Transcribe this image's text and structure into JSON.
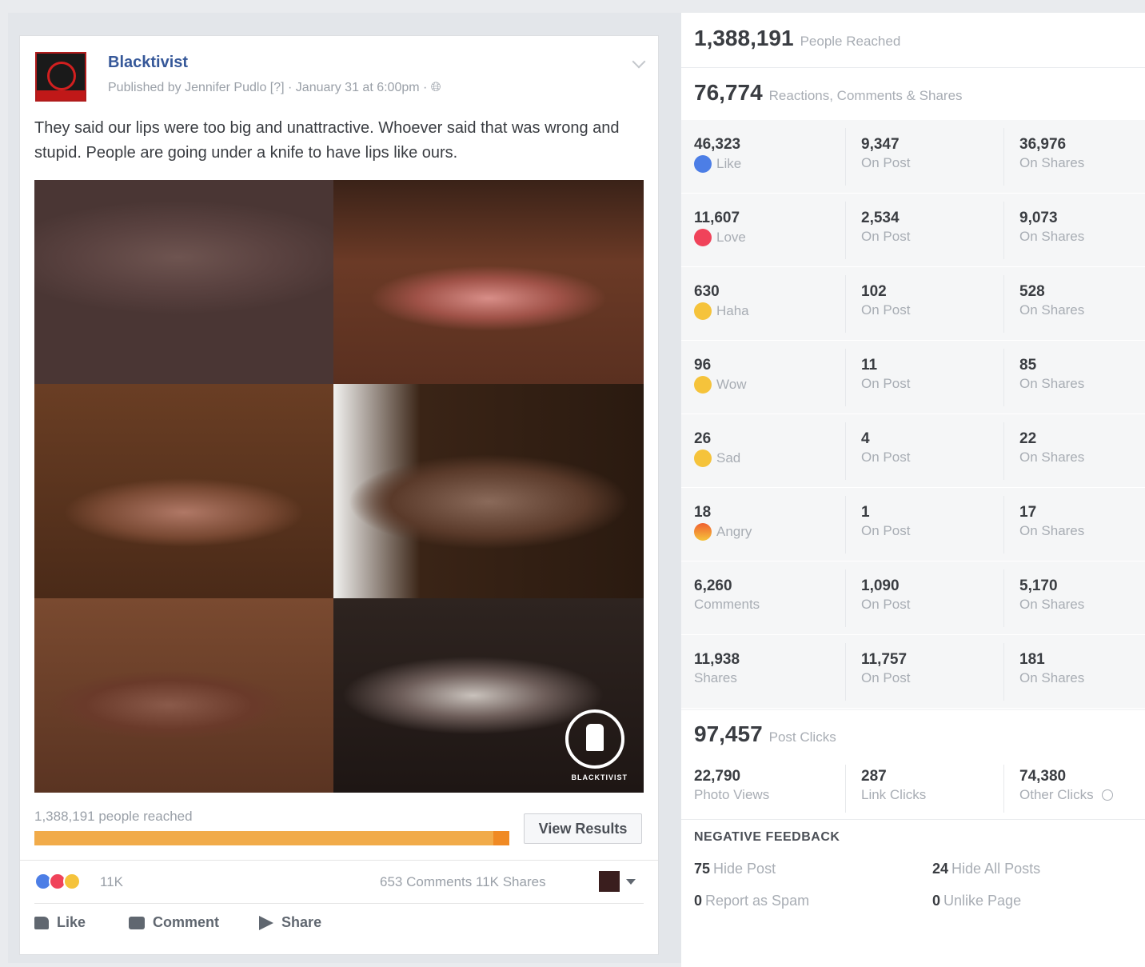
{
  "post": {
    "page_name": "Blacktivist",
    "meta": "Published by Jennifer Pudlo [?] · January 31 at 6:00pm · ",
    "text": "They said our lips were too big and unattractive. Whoever said that was wrong and stupid. People are going under a knife to have lips like ours.",
    "logo_word": "BLACKTIVIST",
    "reach_text": "1,388,191 people reached",
    "view_results_label": "View Results",
    "reaction_count": "11K",
    "comments_shares": "653 Comments  11K Shares",
    "actions": {
      "like": "Like",
      "comment": "Comment",
      "share": "Share"
    },
    "reach_fill_fraction": 1.0
  },
  "insights": {
    "people_reached": {
      "value": "1,388,191",
      "label": "People Reached"
    },
    "engagement": {
      "value": "76,774",
      "label": "Reactions, Comments & Shares"
    },
    "rows": [
      {
        "icon": "like-icon",
        "total": "46,323",
        "label": "Like",
        "on_post": "9,347",
        "on_shares": "36,976"
      },
      {
        "icon": "love-icon",
        "total": "11,607",
        "label": "Love",
        "on_post": "2,534",
        "on_shares": "9,073"
      },
      {
        "icon": "haha-icon",
        "total": "630",
        "label": "Haha",
        "on_post": "102",
        "on_shares": "528"
      },
      {
        "icon": "wow-icon",
        "total": "96",
        "label": "Wow",
        "on_post": "11",
        "on_shares": "85"
      },
      {
        "icon": "sad-icon",
        "total": "26",
        "label": "Sad",
        "on_post": "4",
        "on_shares": "22"
      },
      {
        "icon": "angry-icon",
        "total": "18",
        "label": "Angry",
        "on_post": "1",
        "on_shares": "17"
      },
      {
        "icon": "",
        "total": "6,260",
        "label": "Comments",
        "on_post": "1,090",
        "on_shares": "5,170"
      },
      {
        "icon": "",
        "total": "11,938",
        "label": "Shares",
        "on_post": "11,757",
        "on_shares": "181"
      }
    ],
    "on_post_label": "On Post",
    "on_shares_label": "On Shares",
    "post_clicks": {
      "value": "97,457",
      "label": "Post Clicks"
    },
    "clicks": [
      {
        "value": "22,790",
        "label": "Photo Views"
      },
      {
        "value": "287",
        "label": "Link Clicks"
      },
      {
        "value": "74,380",
        "label": "Other Clicks"
      }
    ],
    "negative_feedback": {
      "title": "NEGATIVE FEEDBACK",
      "items": [
        {
          "value": "75",
          "label": "Hide Post"
        },
        {
          "value": "24",
          "label": "Hide All Posts"
        },
        {
          "value": "0",
          "label": "Report as Spam"
        },
        {
          "value": "0",
          "label": "Unlike Page"
        }
      ]
    }
  },
  "colors": {
    "link": "#365899",
    "reach_bar": "#f1ab4a",
    "like": "#4c7ee6",
    "love": "#f0435a",
    "haha": "#f5c33b"
  }
}
